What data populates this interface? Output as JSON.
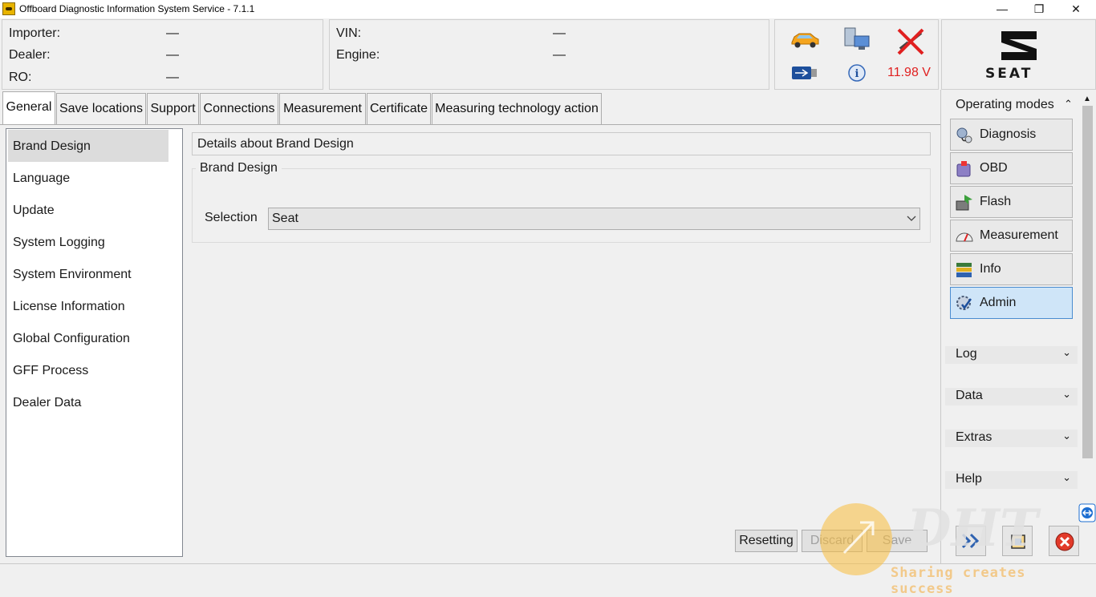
{
  "window": {
    "title": "Offboard Diagnostic Information System Service - 7.1.1",
    "minimize": "—",
    "restore": "❐",
    "close": "✕"
  },
  "header": {
    "importer_label": "Importer:",
    "importer_value": "—",
    "dealer_label": "Dealer:",
    "dealer_value": "—",
    "ro_label": "RO:",
    "ro_value": "—",
    "vin_label": "VIN:",
    "vin_value": "—",
    "engine_label": "Engine:",
    "engine_value": "—",
    "voltage": "11.98 V",
    "brand_logo": "SEAT"
  },
  "tabs": [
    {
      "label": "General"
    },
    {
      "label": "Save locations"
    },
    {
      "label": "Support"
    },
    {
      "label": "Connections"
    },
    {
      "label": "Measurement"
    },
    {
      "label": "Certificate"
    },
    {
      "label": "Measuring technology action"
    }
  ],
  "leftnav": {
    "items": [
      {
        "label": "Brand Design"
      },
      {
        "label": "Language"
      },
      {
        "label": "Update"
      },
      {
        "label": "System Logging"
      },
      {
        "label": "System Environment"
      },
      {
        "label": "License Information"
      },
      {
        "label": "Global Configuration"
      },
      {
        "label": "GFF Process"
      },
      {
        "label": "Dealer Data"
      }
    ],
    "selected": "Brand Design"
  },
  "main": {
    "details_title": "Details about Brand Design",
    "group_title": "Brand Design",
    "selection_label": "Selection",
    "selection_value": "Seat",
    "resetting": "Resetting",
    "discard": "Discard",
    "save": "Save"
  },
  "rightpanel": {
    "operating_modes": "Operating modes",
    "modes": [
      {
        "label": "Diagnosis",
        "icon": "stethoscope-icon"
      },
      {
        "label": "OBD",
        "icon": "obd-icon"
      },
      {
        "label": "Flash",
        "icon": "flash-icon"
      },
      {
        "label": "Measurement",
        "icon": "gauge-icon"
      },
      {
        "label": "Info",
        "icon": "books-icon"
      },
      {
        "label": "Admin",
        "icon": "gear-check-icon"
      }
    ],
    "active_mode": "Admin",
    "sections": [
      {
        "label": "Log"
      },
      {
        "label": "Data"
      },
      {
        "label": "Extras"
      },
      {
        "label": "Help"
      }
    ]
  },
  "watermark": {
    "text": "Sharing creates success",
    "logo": "DHT"
  },
  "colors": {
    "voltage_red": "#e02020",
    "admin_active_bg": "#cfe5f8",
    "admin_active_border": "#4a8cd0"
  }
}
